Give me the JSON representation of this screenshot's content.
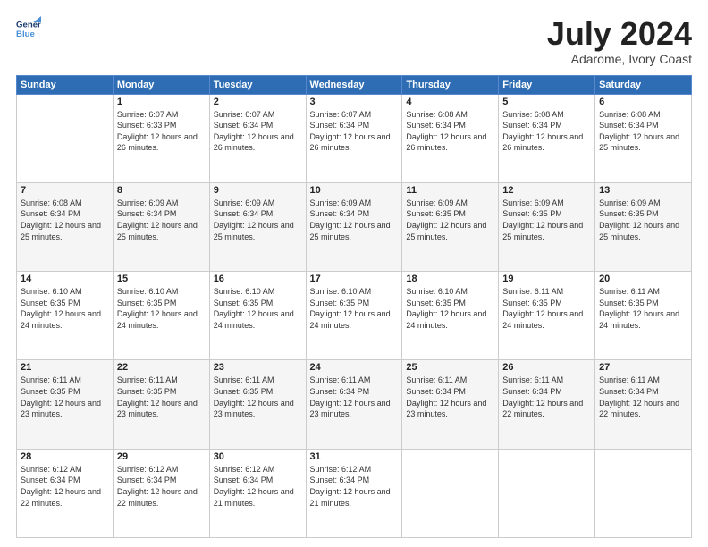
{
  "header": {
    "logo_line1": "General",
    "logo_line2": "Blue",
    "title": "July 2024",
    "subtitle": "Adarome, Ivory Coast"
  },
  "weekdays": [
    "Sunday",
    "Monday",
    "Tuesday",
    "Wednesday",
    "Thursday",
    "Friday",
    "Saturday"
  ],
  "weeks": [
    [
      {
        "day": "",
        "sunrise": "",
        "sunset": "",
        "daylight": ""
      },
      {
        "day": "1",
        "sunrise": "Sunrise: 6:07 AM",
        "sunset": "Sunset: 6:33 PM",
        "daylight": "Daylight: 12 hours and 26 minutes."
      },
      {
        "day": "2",
        "sunrise": "Sunrise: 6:07 AM",
        "sunset": "Sunset: 6:34 PM",
        "daylight": "Daylight: 12 hours and 26 minutes."
      },
      {
        "day": "3",
        "sunrise": "Sunrise: 6:07 AM",
        "sunset": "Sunset: 6:34 PM",
        "daylight": "Daylight: 12 hours and 26 minutes."
      },
      {
        "day": "4",
        "sunrise": "Sunrise: 6:08 AM",
        "sunset": "Sunset: 6:34 PM",
        "daylight": "Daylight: 12 hours and 26 minutes."
      },
      {
        "day": "5",
        "sunrise": "Sunrise: 6:08 AM",
        "sunset": "Sunset: 6:34 PM",
        "daylight": "Daylight: 12 hours and 26 minutes."
      },
      {
        "day": "6",
        "sunrise": "Sunrise: 6:08 AM",
        "sunset": "Sunset: 6:34 PM",
        "daylight": "Daylight: 12 hours and 25 minutes."
      }
    ],
    [
      {
        "day": "7",
        "sunrise": "Sunrise: 6:08 AM",
        "sunset": "Sunset: 6:34 PM",
        "daylight": "Daylight: 12 hours and 25 minutes."
      },
      {
        "day": "8",
        "sunrise": "Sunrise: 6:09 AM",
        "sunset": "Sunset: 6:34 PM",
        "daylight": "Daylight: 12 hours and 25 minutes."
      },
      {
        "day": "9",
        "sunrise": "Sunrise: 6:09 AM",
        "sunset": "Sunset: 6:34 PM",
        "daylight": "Daylight: 12 hours and 25 minutes."
      },
      {
        "day": "10",
        "sunrise": "Sunrise: 6:09 AM",
        "sunset": "Sunset: 6:34 PM",
        "daylight": "Daylight: 12 hours and 25 minutes."
      },
      {
        "day": "11",
        "sunrise": "Sunrise: 6:09 AM",
        "sunset": "Sunset: 6:35 PM",
        "daylight": "Daylight: 12 hours and 25 minutes."
      },
      {
        "day": "12",
        "sunrise": "Sunrise: 6:09 AM",
        "sunset": "Sunset: 6:35 PM",
        "daylight": "Daylight: 12 hours and 25 minutes."
      },
      {
        "day": "13",
        "sunrise": "Sunrise: 6:09 AM",
        "sunset": "Sunset: 6:35 PM",
        "daylight": "Daylight: 12 hours and 25 minutes."
      }
    ],
    [
      {
        "day": "14",
        "sunrise": "Sunrise: 6:10 AM",
        "sunset": "Sunset: 6:35 PM",
        "daylight": "Daylight: 12 hours and 24 minutes."
      },
      {
        "day": "15",
        "sunrise": "Sunrise: 6:10 AM",
        "sunset": "Sunset: 6:35 PM",
        "daylight": "Daylight: 12 hours and 24 minutes."
      },
      {
        "day": "16",
        "sunrise": "Sunrise: 6:10 AM",
        "sunset": "Sunset: 6:35 PM",
        "daylight": "Daylight: 12 hours and 24 minutes."
      },
      {
        "day": "17",
        "sunrise": "Sunrise: 6:10 AM",
        "sunset": "Sunset: 6:35 PM",
        "daylight": "Daylight: 12 hours and 24 minutes."
      },
      {
        "day": "18",
        "sunrise": "Sunrise: 6:10 AM",
        "sunset": "Sunset: 6:35 PM",
        "daylight": "Daylight: 12 hours and 24 minutes."
      },
      {
        "day": "19",
        "sunrise": "Sunrise: 6:11 AM",
        "sunset": "Sunset: 6:35 PM",
        "daylight": "Daylight: 12 hours and 24 minutes."
      },
      {
        "day": "20",
        "sunrise": "Sunrise: 6:11 AM",
        "sunset": "Sunset: 6:35 PM",
        "daylight": "Daylight: 12 hours and 24 minutes."
      }
    ],
    [
      {
        "day": "21",
        "sunrise": "Sunrise: 6:11 AM",
        "sunset": "Sunset: 6:35 PM",
        "daylight": "Daylight: 12 hours and 23 minutes."
      },
      {
        "day": "22",
        "sunrise": "Sunrise: 6:11 AM",
        "sunset": "Sunset: 6:35 PM",
        "daylight": "Daylight: 12 hours and 23 minutes."
      },
      {
        "day": "23",
        "sunrise": "Sunrise: 6:11 AM",
        "sunset": "Sunset: 6:35 PM",
        "daylight": "Daylight: 12 hours and 23 minutes."
      },
      {
        "day": "24",
        "sunrise": "Sunrise: 6:11 AM",
        "sunset": "Sunset: 6:34 PM",
        "daylight": "Daylight: 12 hours and 23 minutes."
      },
      {
        "day": "25",
        "sunrise": "Sunrise: 6:11 AM",
        "sunset": "Sunset: 6:34 PM",
        "daylight": "Daylight: 12 hours and 23 minutes."
      },
      {
        "day": "26",
        "sunrise": "Sunrise: 6:11 AM",
        "sunset": "Sunset: 6:34 PM",
        "daylight": "Daylight: 12 hours and 22 minutes."
      },
      {
        "day": "27",
        "sunrise": "Sunrise: 6:11 AM",
        "sunset": "Sunset: 6:34 PM",
        "daylight": "Daylight: 12 hours and 22 minutes."
      }
    ],
    [
      {
        "day": "28",
        "sunrise": "Sunrise: 6:12 AM",
        "sunset": "Sunset: 6:34 PM",
        "daylight": "Daylight: 12 hours and 22 minutes."
      },
      {
        "day": "29",
        "sunrise": "Sunrise: 6:12 AM",
        "sunset": "Sunset: 6:34 PM",
        "daylight": "Daylight: 12 hours and 22 minutes."
      },
      {
        "day": "30",
        "sunrise": "Sunrise: 6:12 AM",
        "sunset": "Sunset: 6:34 PM",
        "daylight": "Daylight: 12 hours and 21 minutes."
      },
      {
        "day": "31",
        "sunrise": "Sunrise: 6:12 AM",
        "sunset": "Sunset: 6:34 PM",
        "daylight": "Daylight: 12 hours and 21 minutes."
      },
      {
        "day": "",
        "sunrise": "",
        "sunset": "",
        "daylight": ""
      },
      {
        "day": "",
        "sunrise": "",
        "sunset": "",
        "daylight": ""
      },
      {
        "day": "",
        "sunrise": "",
        "sunset": "",
        "daylight": ""
      }
    ]
  ]
}
